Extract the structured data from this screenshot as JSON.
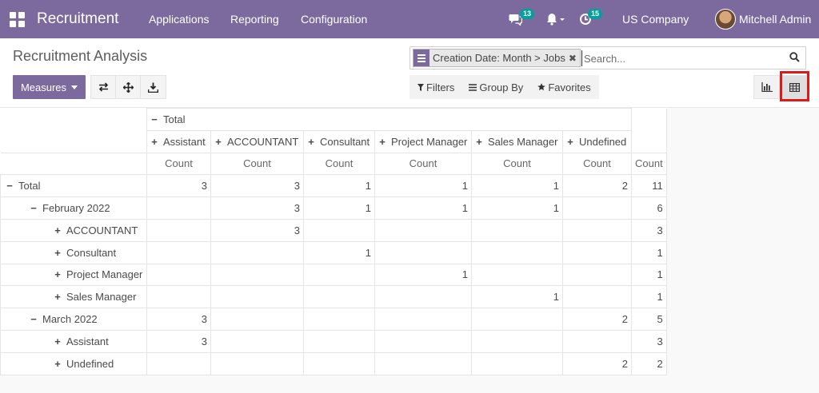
{
  "navbar": {
    "brand": "Recruitment",
    "menus": [
      "Applications",
      "Reporting",
      "Configuration"
    ],
    "messages_count": "13",
    "activities_count": "15",
    "company": "US Company",
    "user": "Mitchell Admin",
    "color": "#7c6a9e"
  },
  "page_title": "Recruitment Analysis",
  "search": {
    "facet": "Creation Date: Month > Jobs",
    "placeholder": "Search..."
  },
  "toolbar": {
    "measures_label": "Measures",
    "filters_label": "Filters",
    "groupby_label": "Group By",
    "favorites_label": "Favorites"
  },
  "pivot": {
    "col_group_label": "Total",
    "columns": [
      "Assistant",
      "ACCOUNTANT",
      "Consultant",
      "Project Manager",
      "Sales Manager",
      "Undefined"
    ],
    "measure": "Count",
    "rows": [
      {
        "label": "Total",
        "level": 0,
        "sign": "−",
        "values": [
          "3",
          "3",
          "1",
          "1",
          "1",
          "2"
        ],
        "total": "11",
        "bold": true
      },
      {
        "label": "February 2022",
        "level": 1,
        "sign": "−",
        "values": [
          "",
          "3",
          "1",
          "1",
          "1",
          ""
        ],
        "total": "6",
        "bold": false
      },
      {
        "label": "ACCOUNTANT",
        "level": 2,
        "sign": "+",
        "values": [
          "",
          "3",
          "",
          "",
          "",
          ""
        ],
        "total": "3",
        "bold": false
      },
      {
        "label": "Consultant",
        "level": 2,
        "sign": "+",
        "values": [
          "",
          "",
          "1",
          "",
          "",
          ""
        ],
        "total": "1",
        "bold": false
      },
      {
        "label": "Project Manager",
        "level": 2,
        "sign": "+",
        "values": [
          "",
          "",
          "",
          "1",
          "",
          ""
        ],
        "total": "1",
        "bold": false
      },
      {
        "label": "Sales Manager",
        "level": 2,
        "sign": "+",
        "values": [
          "",
          "",
          "",
          "",
          "1",
          ""
        ],
        "total": "1",
        "bold": false
      },
      {
        "label": "March 2022",
        "level": 1,
        "sign": "−",
        "values": [
          "3",
          "",
          "",
          "",
          "",
          "2"
        ],
        "total": "5",
        "bold": false
      },
      {
        "label": "Assistant",
        "level": 2,
        "sign": "+",
        "values": [
          "3",
          "",
          "",
          "",
          "",
          ""
        ],
        "total": "3",
        "bold": false
      },
      {
        "label": "Undefined",
        "level": 2,
        "sign": "+",
        "values": [
          "",
          "",
          "",
          "",
          "",
          "2"
        ],
        "total": "2",
        "bold": false
      }
    ]
  }
}
